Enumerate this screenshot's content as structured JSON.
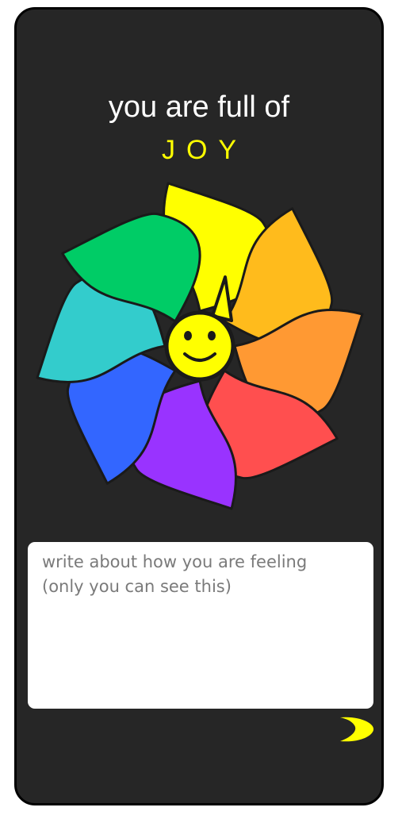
{
  "screen": {
    "headline": "you are full of",
    "emotion_label": "JOY",
    "accent_color": "#ffff00",
    "background_color": "#262626"
  },
  "emotion_wheel": {
    "selected": "yellow",
    "petals": [
      {
        "name": "yellow",
        "color": "#ffff00"
      },
      {
        "name": "amber",
        "color": "#ffbb1c"
      },
      {
        "name": "orange",
        "color": "#ff9933"
      },
      {
        "name": "red",
        "color": "#ff4f4f"
      },
      {
        "name": "purple",
        "color": "#9933ff"
      },
      {
        "name": "blue",
        "color": "#3366ff"
      },
      {
        "name": "teal",
        "color": "#33cccc"
      },
      {
        "name": "green",
        "color": "#00cc66"
      }
    ],
    "center_icon": "smiley-face-icon"
  },
  "journal": {
    "placeholder": "write about how you are feeling\n(only you can see this)",
    "value": ""
  },
  "navigation": {
    "next_icon": "crescent-arrow-icon",
    "next_color": "#ffff00"
  }
}
